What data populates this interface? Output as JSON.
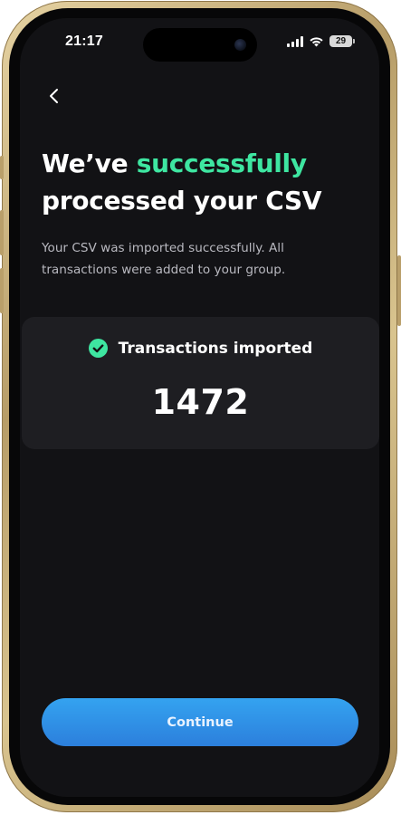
{
  "status_bar": {
    "time": "21:17",
    "battery_level": "29",
    "icons": [
      "signal-icon",
      "wifi-icon",
      "battery-icon"
    ]
  },
  "nav": {
    "back_icon": "chevron-left-icon"
  },
  "headline": {
    "prefix": "We’ve ",
    "accent": "successfully",
    "suffix": "processed your CSV"
  },
  "subtitle": "Your CSV was imported successfully. All transactions were added to your group.",
  "result": {
    "icon": "check-circle-icon",
    "label": "Transactions imported",
    "count": "1472"
  },
  "continue_button": {
    "label": "Continue"
  },
  "colors": {
    "accent_green": "#3ee6a1",
    "background": "#121215",
    "card": "#1e1e22",
    "button_blue": "#2f8fe6"
  }
}
